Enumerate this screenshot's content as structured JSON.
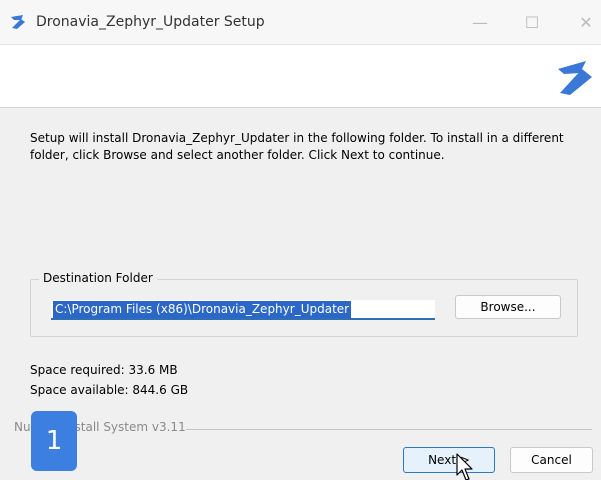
{
  "window": {
    "title": "Dronavia_Zephyr_Updater Setup",
    "icons": {
      "app": "app-logo-icon",
      "minimize": "minimize-icon",
      "maximize": "maximize-icon",
      "close": "close-icon"
    },
    "minimize_glyph": "—",
    "maximize_glyph": "☐",
    "close_glyph": "✕"
  },
  "header": {
    "logo": "brand-logo-icon"
  },
  "content": {
    "intro_text": "Setup will install Dronavia_Zephyr_Updater in the following folder. To install in a different folder, click Browse and select another folder. Click Next to continue.",
    "destination": {
      "label": "Destination Folder",
      "path_value": "C:\\Program Files (x86)\\Dronavia_Zephyr_Updater",
      "browse_label": "Browse..."
    },
    "space_required": "Space required: 33.6 MB",
    "space_available": "Space available: 844.6 GB"
  },
  "footer": {
    "branding_text": "Nullsoft Install System v3.11",
    "next_label": "Next >",
    "cancel_label": "Cancel"
  },
  "overlay": {
    "step_number": "1"
  },
  "colors": {
    "accent": "#2b67c7",
    "badge": "#3d7fe0",
    "logo": "#3a78d8"
  }
}
